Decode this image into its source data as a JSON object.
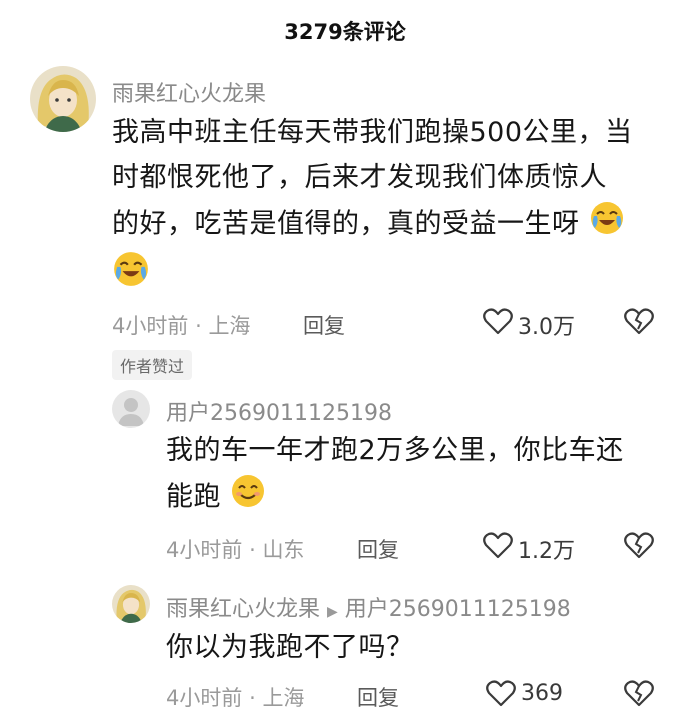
{
  "header": {
    "title": "3279条评论"
  },
  "comments": [
    {
      "username": "雨果红心火龙果",
      "text_lines": [
        "我高中班主任每天带我们跑操500公里，当",
        "时都恨死他了，后来才发现我们体质惊人",
        "的好，吃苦是值得的，真的受益一生呀"
      ],
      "time": "4小时前",
      "dot": "·",
      "location": "上海",
      "reply_label": "回复",
      "likes": "3.0万",
      "author_badge": "作者赞过"
    }
  ],
  "replies": [
    {
      "username": "用户2569011125198",
      "text_lines": [
        "我的车一年才跑2万多公里，你比车还",
        "能跑"
      ],
      "time": "4小时前",
      "dot": "·",
      "location": "山东",
      "reply_label": "回复",
      "likes": "1.2万"
    },
    {
      "username": "雨果红心火龙果",
      "reply_to": "用户2569011125198",
      "text_lines": [
        "你以为我跑不了吗？"
      ],
      "time": "4小时前",
      "dot": "·",
      "location": "上海",
      "reply_label": "回复",
      "likes": "369"
    }
  ],
  "icons": {
    "like": "heart-outline-icon",
    "dislike": "broken-heart-icon",
    "cry_emoji": "crying-laughing-emoji",
    "smile_emoji": "smiling-emoji",
    "reply_arrow": "triangle-right-icon"
  },
  "colors": {
    "emoji_yellow": "#f7c531",
    "tear_blue": "#5aa9e6",
    "muted": "#9a9a9a"
  }
}
